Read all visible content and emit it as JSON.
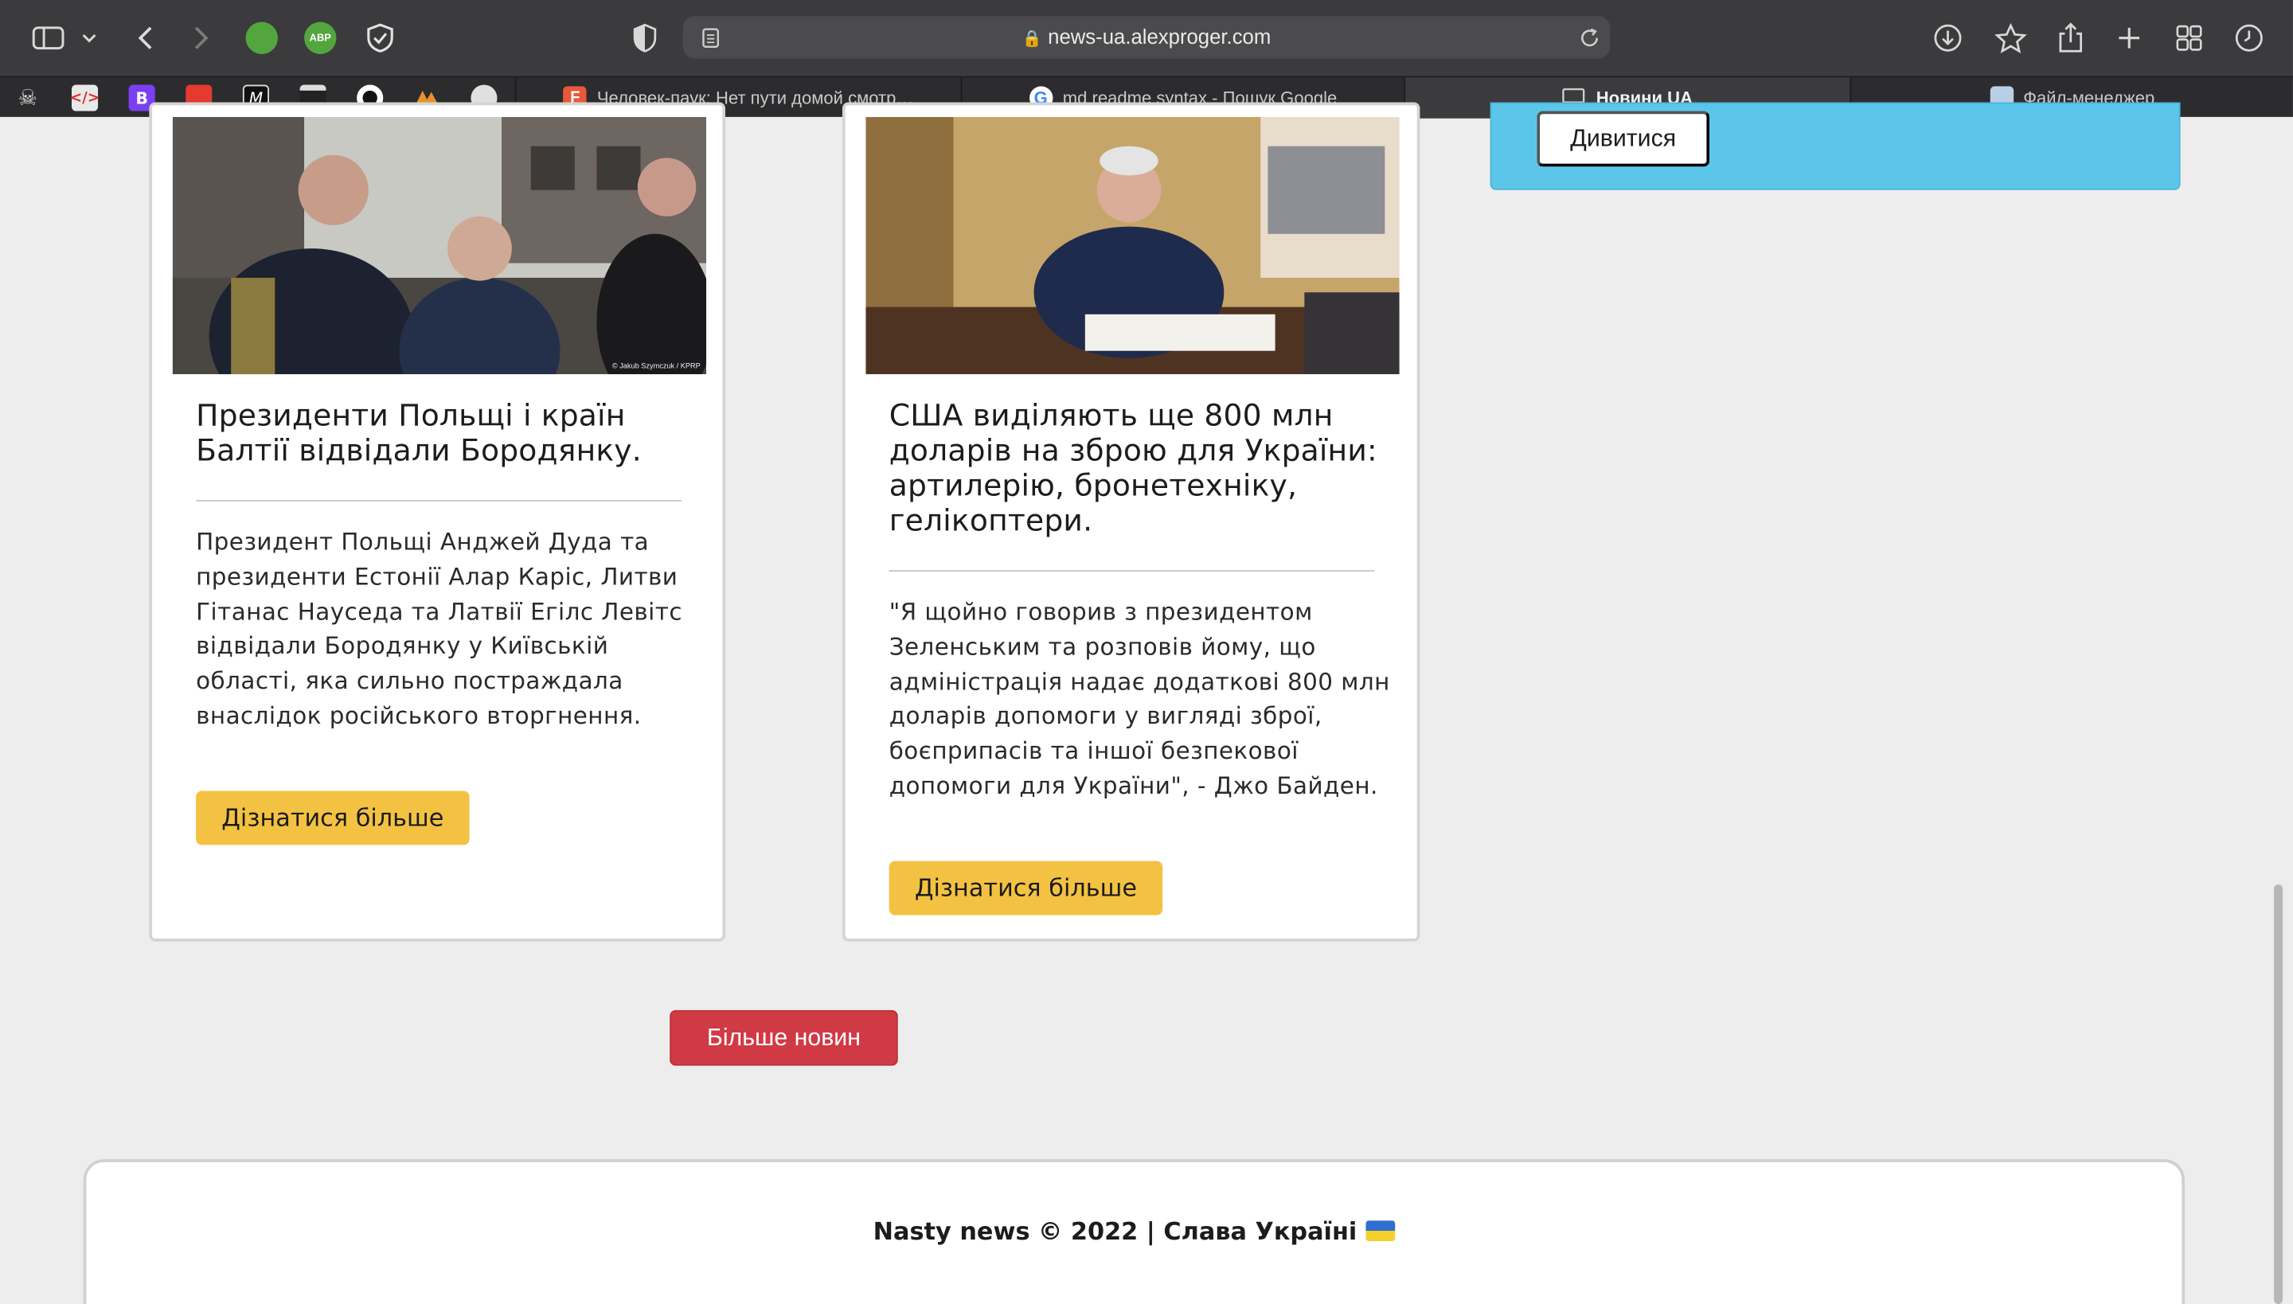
{
  "browser": {
    "url": "news-ua.alexproger.com",
    "extensions": {
      "abp_label": "ABP"
    },
    "tabs": [
      {
        "label": "Человек-паук: Нет пути домой смотр…",
        "favicon_color": "#e8583b",
        "favicon_letter": "F"
      },
      {
        "label": "md readme syntax - Пошук Google",
        "favicon_letter": "G"
      },
      {
        "label": "Новини UA",
        "active": true
      },
      {
        "label": "Файл-менеджер"
      }
    ]
  },
  "news_cards": [
    {
      "title": "Президенти Польщі і країн Балтії відвідали Бородянку.",
      "text": "Президент Польщі Анджей Дуда та президенти Естонії Алар Каріс, Литви Гітанас Науседа та Латвії Егілс Левітс відвідали Бородянку у Київській області, яка сильно постраждала внаслідок російського вторгнення.",
      "button": "Дізнатися більше",
      "image_credit": "© Jakub Szymczuk / KPRP"
    },
    {
      "title": "США виділяють ще 800 млн доларів на зброю для України: артилерію, бронетехніку, гелікоптери.",
      "text": "\"Я щойно говорив з президентом Зеленським та розповів йому, що адміністрація надає додаткові 800 млн доларів допомоги у вигляді зброї, боєприпасів та іншої безпекової допомоги для України\", - Джо Байден.",
      "button": "Дізнатися більше"
    }
  ],
  "sidebar": {
    "watch_button": "Дивитися"
  },
  "more_news_button": "Більше новин",
  "footer": {
    "text": "Nasty news © 2022 | Слава Україні"
  },
  "colors": {
    "accent_yellow": "#f4c242",
    "accent_red": "#d03a44",
    "accent_blue": "#5cc6ea"
  }
}
